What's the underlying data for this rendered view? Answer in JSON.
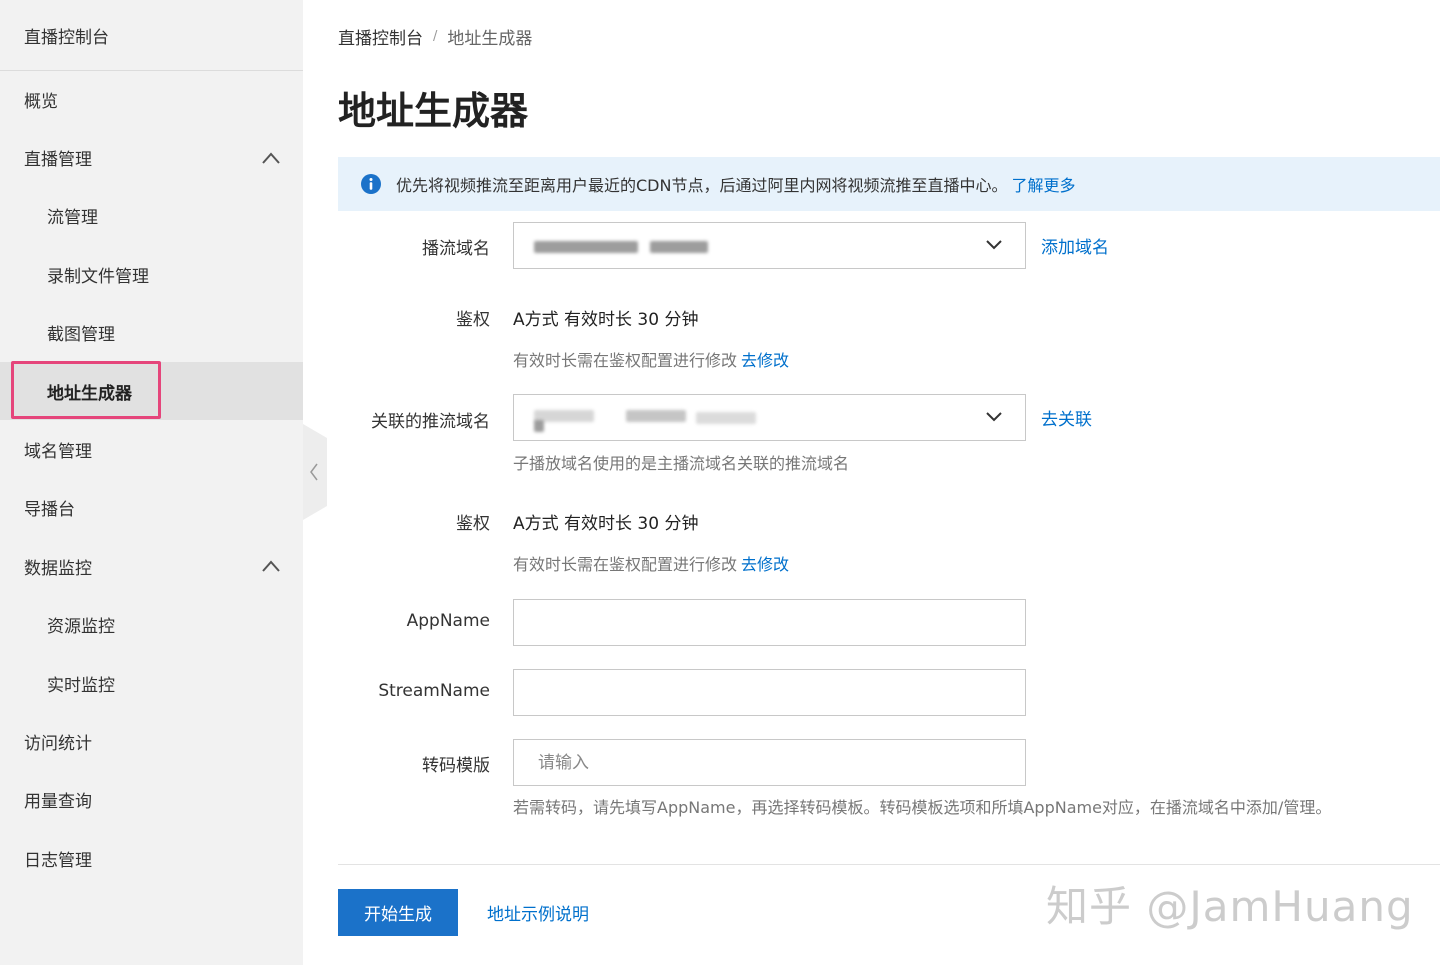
{
  "sidebar": {
    "title": "直播控制台",
    "items": [
      {
        "label": "概览"
      },
      {
        "label": "直播管理"
      },
      {
        "label": "流管理"
      },
      {
        "label": "录制文件管理"
      },
      {
        "label": "截图管理"
      },
      {
        "label": "地址生成器"
      },
      {
        "label": "域名管理"
      },
      {
        "label": "导播台"
      },
      {
        "label": "数据监控"
      },
      {
        "label": "资源监控"
      },
      {
        "label": "实时监控"
      },
      {
        "label": "访问统计"
      },
      {
        "label": "用量查询"
      },
      {
        "label": "日志管理"
      }
    ],
    "active_item": "地址生成器"
  },
  "breadcrumb": {
    "root": "直播控制台",
    "separator": "/",
    "current": "地址生成器"
  },
  "page_title": "地址生成器",
  "notice": {
    "text": "优先将视频推流至距离用户最近的CDN节点，后通过阿里内网将视频流推至直播中心。",
    "link": "了解更多"
  },
  "form": {
    "play_domain": {
      "label": "播流域名",
      "add_link": "添加域名"
    },
    "auth1": {
      "label": "鉴权",
      "value": "A方式 有效时长 30 分钟",
      "help": "有效时长需在鉴权配置进行修改",
      "help_link": "去修改"
    },
    "push_domain": {
      "label": "关联的推流域名",
      "link": "去关联",
      "help": "子播放域名使用的是主播流域名关联的推流域名"
    },
    "auth2": {
      "label": "鉴权",
      "value": "A方式 有效时长 30 分钟",
      "help": "有效时长需在鉴权配置进行修改",
      "help_link": "去修改"
    },
    "app_name": {
      "label": "AppName",
      "value": ""
    },
    "stream_name": {
      "label": "StreamName",
      "value": ""
    },
    "transcode": {
      "label": "转码模版",
      "placeholder": "请输入",
      "help": "若需转码，请先填写AppName，再选择转码模板。转码模板选项和所填AppName对应，在播流域名中添加/管理。"
    }
  },
  "actions": {
    "primary": "开始生成",
    "secondary": "地址示例说明"
  },
  "watermark": "知乎 @JamHuang",
  "colors": {
    "accent": "#1b72c9",
    "link": "#0070cc",
    "highlight_border": "#e5457b",
    "notice_bg": "#e7f2fb",
    "sidebar_bg": "#f2f2f2"
  }
}
